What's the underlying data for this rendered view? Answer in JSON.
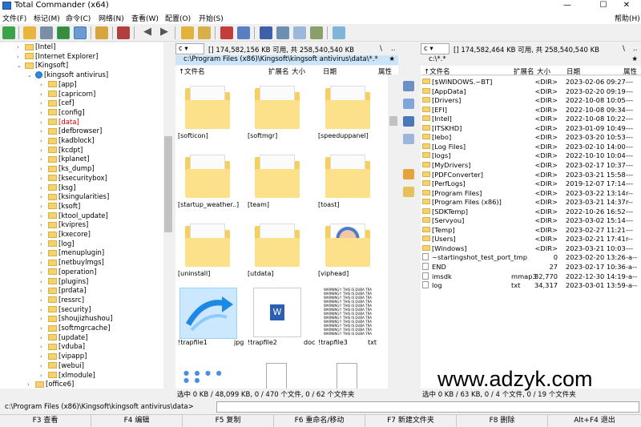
{
  "window": {
    "title": "Total Commander (x64)",
    "min": "—",
    "max": "☐",
    "close": "✕"
  },
  "menu": [
    "文件(F)",
    "标记(M)",
    "命令(C)",
    "网络(N)",
    "查看(W)",
    "配置(O)",
    "开始(S)"
  ],
  "menu_help": "帮助(H)",
  "tree": {
    "items": [
      {
        "label": "[Intel]",
        "indent": 0,
        "open": false
      },
      {
        "label": "[Internet Explorer]",
        "indent": 0,
        "open": false
      },
      {
        "label": "[Kingsoft]",
        "indent": 0,
        "open": true
      },
      {
        "label": "[kingsoft antivirus]",
        "indent": 1,
        "open": true,
        "special": true
      },
      {
        "label": "[app]",
        "indent": 2
      },
      {
        "label": "[capricorn]",
        "indent": 2
      },
      {
        "label": "[cef]",
        "indent": 2
      },
      {
        "label": "[config]",
        "indent": 2
      },
      {
        "label": "[data]",
        "indent": 2,
        "current": true
      },
      {
        "label": "[defbrowser]",
        "indent": 2
      },
      {
        "label": "[kadblock]",
        "indent": 2
      },
      {
        "label": "[kcdpt]",
        "indent": 2
      },
      {
        "label": "[kplanet]",
        "indent": 2
      },
      {
        "label": "[ks_dump]",
        "indent": 2
      },
      {
        "label": "[ksecuritybox]",
        "indent": 2
      },
      {
        "label": "[ksg]",
        "indent": 2
      },
      {
        "label": "[ksingularities]",
        "indent": 2
      },
      {
        "label": "[ksoft]",
        "indent": 2
      },
      {
        "label": "[ktool_update]",
        "indent": 2
      },
      {
        "label": "[kvipres]",
        "indent": 2
      },
      {
        "label": "[kxecore]",
        "indent": 2
      },
      {
        "label": "[log]",
        "indent": 2
      },
      {
        "label": "[menuplugin]",
        "indent": 2
      },
      {
        "label": "[netbuylmgs]",
        "indent": 2
      },
      {
        "label": "[operation]",
        "indent": 2
      },
      {
        "label": "[plugins]",
        "indent": 2
      },
      {
        "label": "[prdata]",
        "indent": 2
      },
      {
        "label": "[ressrc]",
        "indent": 2
      },
      {
        "label": "[security]",
        "indent": 2
      },
      {
        "label": "[shoujizhushou]",
        "indent": 2
      },
      {
        "label": "[softmgrcache]",
        "indent": 2
      },
      {
        "label": "[update]",
        "indent": 2
      },
      {
        "label": "[vduba]",
        "indent": 2
      },
      {
        "label": "[vipapp]",
        "indent": 2
      },
      {
        "label": "[webui]",
        "indent": 2
      },
      {
        "label": "[xlmodule]",
        "indent": 2
      },
      {
        "label": "[office6]",
        "indent": 1
      }
    ]
  },
  "left_panel": {
    "drive": "c",
    "free": "[]  174,582,156 KB 可用, 共 258,540,540 KB",
    "root_btn": "\\",
    "up_btn": "..",
    "path": "c:\\Program Files (x86)\\Kingsoft\\kingsoft antivirus\\data\\*.*",
    "star": "★",
    "cols": {
      "name": "↑文件名",
      "ext": "扩展名",
      "size": "大小",
      "date": "日期",
      "attr": "属性"
    },
    "thumbs": [
      {
        "name": "[softicon]",
        "ext": "",
        "type": "folder"
      },
      {
        "name": "[softmgr]",
        "ext": "",
        "type": "folder"
      },
      {
        "name": "[speeduppanel]",
        "ext": "",
        "type": "folder"
      },
      {
        "name": "[startup_weather..]",
        "ext": "",
        "type": "folder"
      },
      {
        "name": "[team]",
        "ext": "",
        "type": "folder"
      },
      {
        "name": "[toast]",
        "ext": "",
        "type": "folder"
      },
      {
        "name": "[uninstall]",
        "ext": "",
        "type": "folder"
      },
      {
        "name": "[utdata]",
        "ext": "",
        "type": "folder"
      },
      {
        "name": "[viphead]",
        "ext": "",
        "type": "folder"
      },
      {
        "name": "!trapfile1",
        "ext": "jpg",
        "type": "jpg"
      },
      {
        "name": "!trapfile2",
        "ext": "doc",
        "type": "doc"
      },
      {
        "name": "!trapfile3",
        "ext": "txt",
        "type": "txt"
      },
      {
        "name": "",
        "ext": "",
        "type": "dots"
      },
      {
        "name": "",
        "ext": "",
        "type": "blank"
      },
      {
        "name": "",
        "ext": "",
        "type": "blank"
      }
    ],
    "txt_preview": "WARNING!! THIS IS DUBA TRA",
    "status": "选中 0 KB / 48,099 KB, 0 / 470 个文件, 0 / 62 个文件夹"
  },
  "right_panel": {
    "drive": "c",
    "free": "[]  174,582,464 KB 可用, 共 258,540,540 KB",
    "root_btn": "\\",
    "up_btn": "..",
    "path": "c:\\*.*",
    "star": "★",
    "cols": {
      "name": "↑文件名",
      "ext": "扩展名",
      "size": "大小",
      "date": "日期",
      "attr": "属性"
    },
    "rows": [
      {
        "name": "[$WINDOWS.~BT]",
        "ext": "",
        "size": "<DIR>",
        "date": "2023-02-06 09:27",
        "attr": "---",
        "file": false
      },
      {
        "name": "[AppData]",
        "ext": "",
        "size": "<DIR>",
        "date": "2023-02-20 09:19",
        "attr": "---",
        "file": false
      },
      {
        "name": "[Drivers]",
        "ext": "",
        "size": "<DIR>",
        "date": "2022-10-08 10:05",
        "attr": "---",
        "file": false
      },
      {
        "name": "[EFI]",
        "ext": "",
        "size": "<DIR>",
        "date": "2022-10-08 09:34",
        "attr": "---",
        "file": false
      },
      {
        "name": "[Intel]",
        "ext": "",
        "size": "<DIR>",
        "date": "2022-10-08 10:22",
        "attr": "---",
        "file": false
      },
      {
        "name": "[ITSKHD]",
        "ext": "",
        "size": "<DIR>",
        "date": "2023-01-09 10:49",
        "attr": "---",
        "file": false
      },
      {
        "name": "[lebo]",
        "ext": "",
        "size": "<DIR>",
        "date": "2023-03-20 10:53",
        "attr": "---",
        "file": false
      },
      {
        "name": "[Log Files]",
        "ext": "",
        "size": "<DIR>",
        "date": "2023-02-10 14:00",
        "attr": "---",
        "file": false
      },
      {
        "name": "[logs]",
        "ext": "",
        "size": "<DIR>",
        "date": "2022-10-10 10:04",
        "attr": "---",
        "file": false
      },
      {
        "name": "[MyDrivers]",
        "ext": "",
        "size": "<DIR>",
        "date": "2023-02-17 10:37",
        "attr": "---",
        "file": false
      },
      {
        "name": "[PDFConverter]",
        "ext": "",
        "size": "<DIR>",
        "date": "2023-03-21 15:58",
        "attr": "---",
        "file": false
      },
      {
        "name": "[PerfLogs]",
        "ext": "",
        "size": "<DIR>",
        "date": "2019-12-07 17:14",
        "attr": "---",
        "file": false
      },
      {
        "name": "[Program Files]",
        "ext": "",
        "size": "<DIR>",
        "date": "2023-03-22 13:14",
        "attr": "r--",
        "file": false
      },
      {
        "name": "[Program Files (x86)]",
        "ext": "",
        "size": "<DIR>",
        "date": "2023-03-21 14:37",
        "attr": "r--",
        "file": false
      },
      {
        "name": "[SDKTemp]",
        "ext": "",
        "size": "<DIR>",
        "date": "2022-10-26 16:52",
        "attr": "---",
        "file": false
      },
      {
        "name": "[Servyou]",
        "ext": "",
        "size": "<DIR>",
        "date": "2023-03-02 15:14",
        "attr": "---",
        "file": false
      },
      {
        "name": "[Temp]",
        "ext": "",
        "size": "<DIR>",
        "date": "2023-02-27 11:21",
        "attr": "---",
        "file": false
      },
      {
        "name": "[Users]",
        "ext": "",
        "size": "<DIR>",
        "date": "2023-02-21 17:41",
        "attr": "r--",
        "file": false
      },
      {
        "name": "[Windows]",
        "ext": "",
        "size": "<DIR>",
        "date": "2023-03-21 10:03",
        "attr": "---",
        "file": false
      },
      {
        "name": "~startingshot_test_port_tmp",
        "ext": "",
        "size": "0",
        "date": "2023-02-20 13:26",
        "attr": "-a--",
        "file": true
      },
      {
        "name": "END",
        "ext": "",
        "size": "27",
        "date": "2023-02-17 10:36",
        "attr": "-a--",
        "file": true
      },
      {
        "name": "imsdk",
        "ext": "mmap3",
        "size": "32,770",
        "date": "2022-12-30 14:19",
        "attr": "-a--",
        "file": true
      },
      {
        "name": "log",
        "ext": "txt",
        "size": "34,317",
        "date": "2023-03-01 13:59",
        "attr": "-a--",
        "file": true
      }
    ],
    "status": "选中 0 KB / 63 KB, 0 / 4 个文件, 0 / 19 个文件夹"
  },
  "cmdline": {
    "path": "c:\\Program Files (x86)\\Kingsoft\\kingsoft antivirus\\data>",
    "value": ""
  },
  "fkeys": [
    "F3 查看",
    "F4 编辑",
    "F5 复制",
    "F6 重命名/移动",
    "F7 新建文件夹",
    "F8 删除",
    "Alt+F4 退出"
  ],
  "watermark": "www.adzyk.com",
  "colors": {
    "path_bg": "#cce4f7",
    "folder": "#f6cf5c",
    "selection": "#cce8ff",
    "current_tree": "#d00000"
  }
}
